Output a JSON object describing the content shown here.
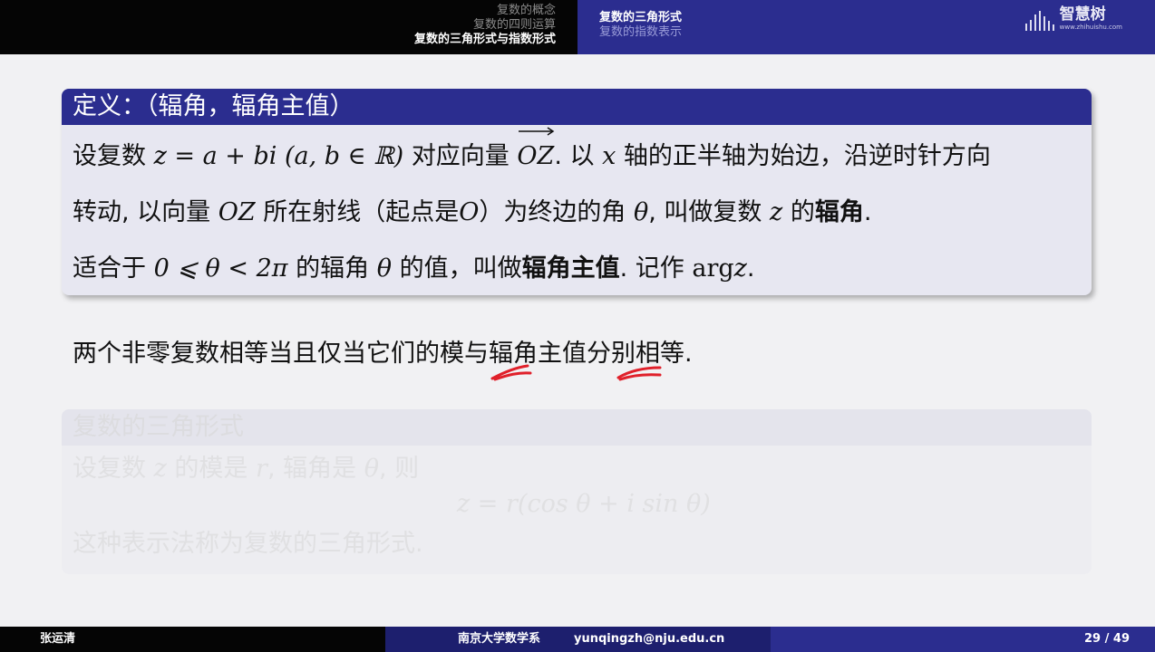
{
  "header": {
    "left_sections": [
      "复数的概念",
      "复数的四则运算"
    ],
    "left_active": "复数的三角形式与指数形式",
    "right_active": "复数的三角形式",
    "right_inactive": "复数的指数表示",
    "logo_name": "智慧树",
    "logo_url": "www.zhihuishu.com"
  },
  "definition": {
    "title": "定义：（辐角，辐角主值）",
    "l1_a": "设复数",
    "l1_z": "z",
    "l1_eq": "= a + bi (a, b ∈ ℝ)",
    "l1_b": "对应向量",
    "l1_vec": "OZ",
    "l1_c": ". 以",
    "l1_x": "x",
    "l1_d": "轴的正半轴为始边，沿逆时针方向",
    "l2_a": "转动, 以向量",
    "l2_oz": "OZ",
    "l2_b": "所在射线（起点是",
    "l2_o": "O",
    "l2_c": "）为终边的角",
    "l2_theta": "θ",
    "l2_d": ", 叫做复数",
    "l2_z": "z",
    "l2_e": "的",
    "l2_bold": "辐角",
    "l2_f": ".",
    "l3_a": "适合于",
    "l3_ineq": "0 ⩽ θ < 2π",
    "l3_b": "的辐角",
    "l3_theta": "θ",
    "l3_c": "的值，叫做",
    "l3_bold": "辐角主值",
    "l3_d": ". 记作",
    "l3_arg": "arg",
    "l3_z": "z",
    "l3_e": "."
  },
  "statement": "两个非零复数相等当且仅当它们的模与辐角主值分别相等.",
  "ghost_block": {
    "title": "复数的三角形式",
    "l1_a": "设复数",
    "l1_z": "z",
    "l1_b": "的模是",
    "l1_r": "r",
    "l1_c": ", 辐角是",
    "l1_theta": "θ",
    "l1_d": ", 则",
    "formula": "z = r(cos θ + i sin θ)",
    "l3": "这种表示法称为复数的三角形式."
  },
  "footer": {
    "author": "张运清",
    "institution": "南京大学数学系",
    "email": "yunqingzh@nju.edu.cn",
    "page": "29 / 49"
  },
  "colors": {
    "theme_blue": "#2b2d8f",
    "block_bg": "#e7e7f1",
    "annotation_red": "#e0202a"
  }
}
